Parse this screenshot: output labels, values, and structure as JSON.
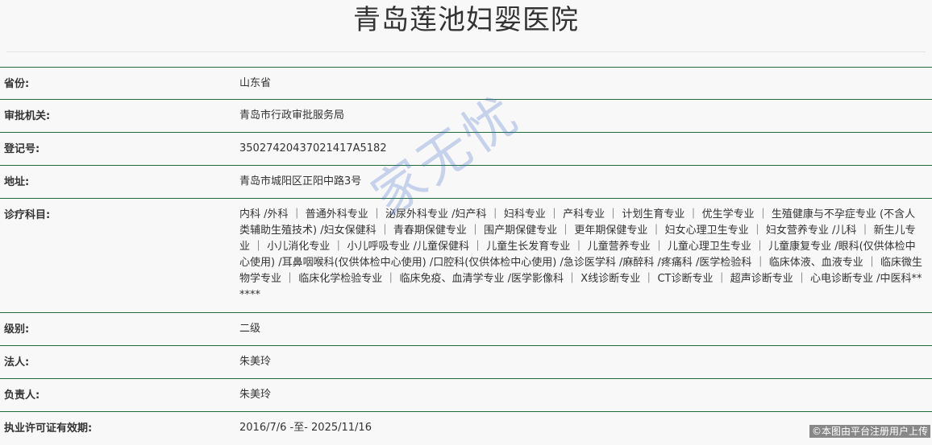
{
  "title": "青岛莲池妇婴医院",
  "rows": [
    {
      "label": "省份:",
      "value": "山东省"
    },
    {
      "label": "审批机关:",
      "value": "青岛市行政审批服务局"
    },
    {
      "label": "登记号:",
      "value": "35027420437021417A5182"
    },
    {
      "label": "地址:",
      "value": "青岛市城阳区正阳中路3号"
    },
    {
      "label": "诊疗科目:",
      "value": "内科 /外科 ｜ 普通外科专业 ｜ 泌尿外科专业 /妇产科 ｜ 妇科专业 ｜ 产科专业 ｜ 计划生育专业 ｜ 优生学专业 ｜ 生殖健康与不孕症专业 (不含人类辅助生殖技术) /妇女保健科 ｜ 青春期保健专业 ｜ 围产期保健专业 ｜ 更年期保健专业 ｜ 妇女心理卫生专业 ｜ 妇女营养专业 /儿科 ｜ 新生儿专业 ｜ 小儿消化专业 ｜ 小儿呼吸专业 /儿童保健科 ｜ 儿童生长发育专业 ｜ 儿童营养专业 ｜ 儿童心理卫生专业 ｜ 儿童康复专业 /眼科(仅供体检中心使用) /耳鼻咽喉科(仅供体检中心使用) /口腔科(仅供体检中心使用) /急诊医学科 /麻醉科 /疼痛科 /医学检验科 ｜ 临床体液、血液专业 ｜ 临床微生物学专业 ｜ 临床化学检验专业 ｜ 临床免疫、血清学专业 /医学影像科 ｜ X线诊断专业 ｜ CT诊断专业 ｜ 超声诊断专业 ｜ 心电诊断专业 /中医科******"
    },
    {
      "label": "级别:",
      "value": "二级"
    },
    {
      "label": "法人:",
      "value": "朱美玲"
    },
    {
      "label": "负责人:",
      "value": "朱美玲"
    },
    {
      "label": "执业许可证有效期:",
      "value": "2016/7/6 -至- 2025/11/16"
    }
  ],
  "watermark": "家无忧",
  "copyright": "©本图由平台注册用户上传",
  "colors": {
    "row_border": "#1f6b3a",
    "background": "#f8f8f8",
    "text": "#333333"
  }
}
